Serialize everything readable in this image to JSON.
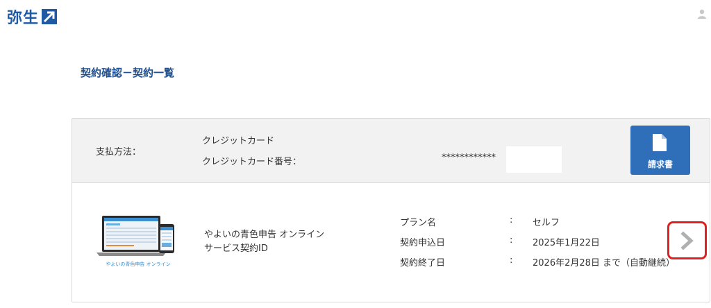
{
  "header": {
    "logo_text": "弥生",
    "logo_icon": "arrow-square-icon",
    "user_icon": "user-icon"
  },
  "page_title": "契約確認－契約一覧",
  "payment": {
    "label": "支払方法：",
    "method": "クレジットカード",
    "card_number_label": "クレジットカード番号：",
    "card_number_value": "************"
  },
  "invoice_button": {
    "label": "請求書",
    "icon": "document-icon"
  },
  "service": {
    "product_image_caption": "やよいの青色申告 オンライン",
    "name_line1": "やよいの青色申告 オンライン",
    "name_line2": "サービス契約ID",
    "details": [
      {
        "label": "プラン名",
        "colon": ":",
        "value": "セルフ"
      },
      {
        "label": "契約申込日",
        "colon": ":",
        "value": "2025年1月22日"
      },
      {
        "label": "契約終了日",
        "colon": ":",
        "value": "2026年2月28日 まで（自動継続）"
      }
    ],
    "chevron_icon": "chevron-right-icon"
  },
  "colors": {
    "brand_blue": "#1f5aa5",
    "button_blue": "#2f6fba",
    "highlight_red": "#e02020"
  }
}
